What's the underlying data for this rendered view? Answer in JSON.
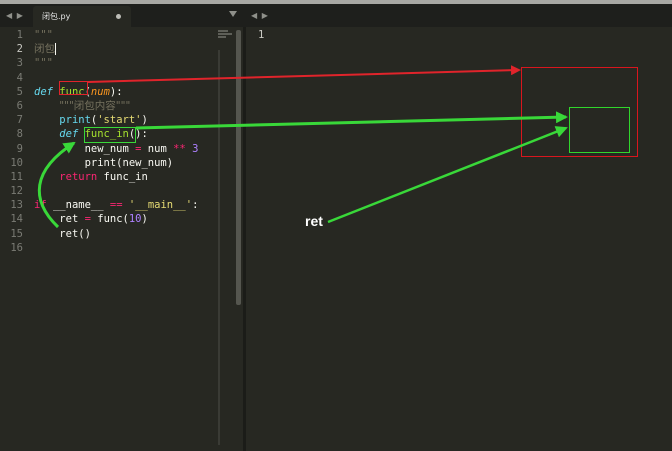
{
  "tab": {
    "filename": "闭包.py",
    "nav_left": "◀ ▶",
    "nav_right": "◀ ▶"
  },
  "editor": {
    "line_numbers": [
      "1",
      "2",
      "3",
      "4",
      "5",
      "6",
      "7",
      "8",
      "9",
      "10",
      "11",
      "12",
      "13",
      "14",
      "15",
      "16"
    ],
    "active_line": "2",
    "lines": {
      "l1": "\"\"\"",
      "l2": "闭包",
      "l3": "\"\"\"",
      "l5_def": "def",
      "l5_func": "func",
      "l5_open": "(",
      "l5_param": "num",
      "l5_close": "):",
      "l6_doc": "\"\"\"闭包内容\"\"\"",
      "l7_print": "print",
      "l7_open": "(",
      "l7_str": "'start'",
      "l7_close": ")",
      "l8_def": "def",
      "l8_func": "func_in",
      "l8_rest": "():",
      "l9_a": "new_num ",
      "l9_eq": "=",
      "l9_b": " num ",
      "l9_op": "**",
      "l9_num": " 3",
      "l10": "print(new_num)",
      "l11_kw": "return",
      "l11_rest": " func_in",
      "l13_if": "if",
      "l13_a": " __name__ ",
      "l13_eq": "==",
      "l13_str": " '__main__'",
      "l13_colon": ":",
      "l14_a": "ret ",
      "l14_eq": "=",
      "l14_b": " func(",
      "l14_num": "10",
      "l14_c": ")",
      "l15": "ret()"
    }
  },
  "right_pane": {
    "line_number": "1"
  },
  "annotations": {
    "ret_label": "ret"
  },
  "colors": {
    "background": "#272822",
    "annotation_red": "#e0242b",
    "annotation_green": "#39d839"
  }
}
